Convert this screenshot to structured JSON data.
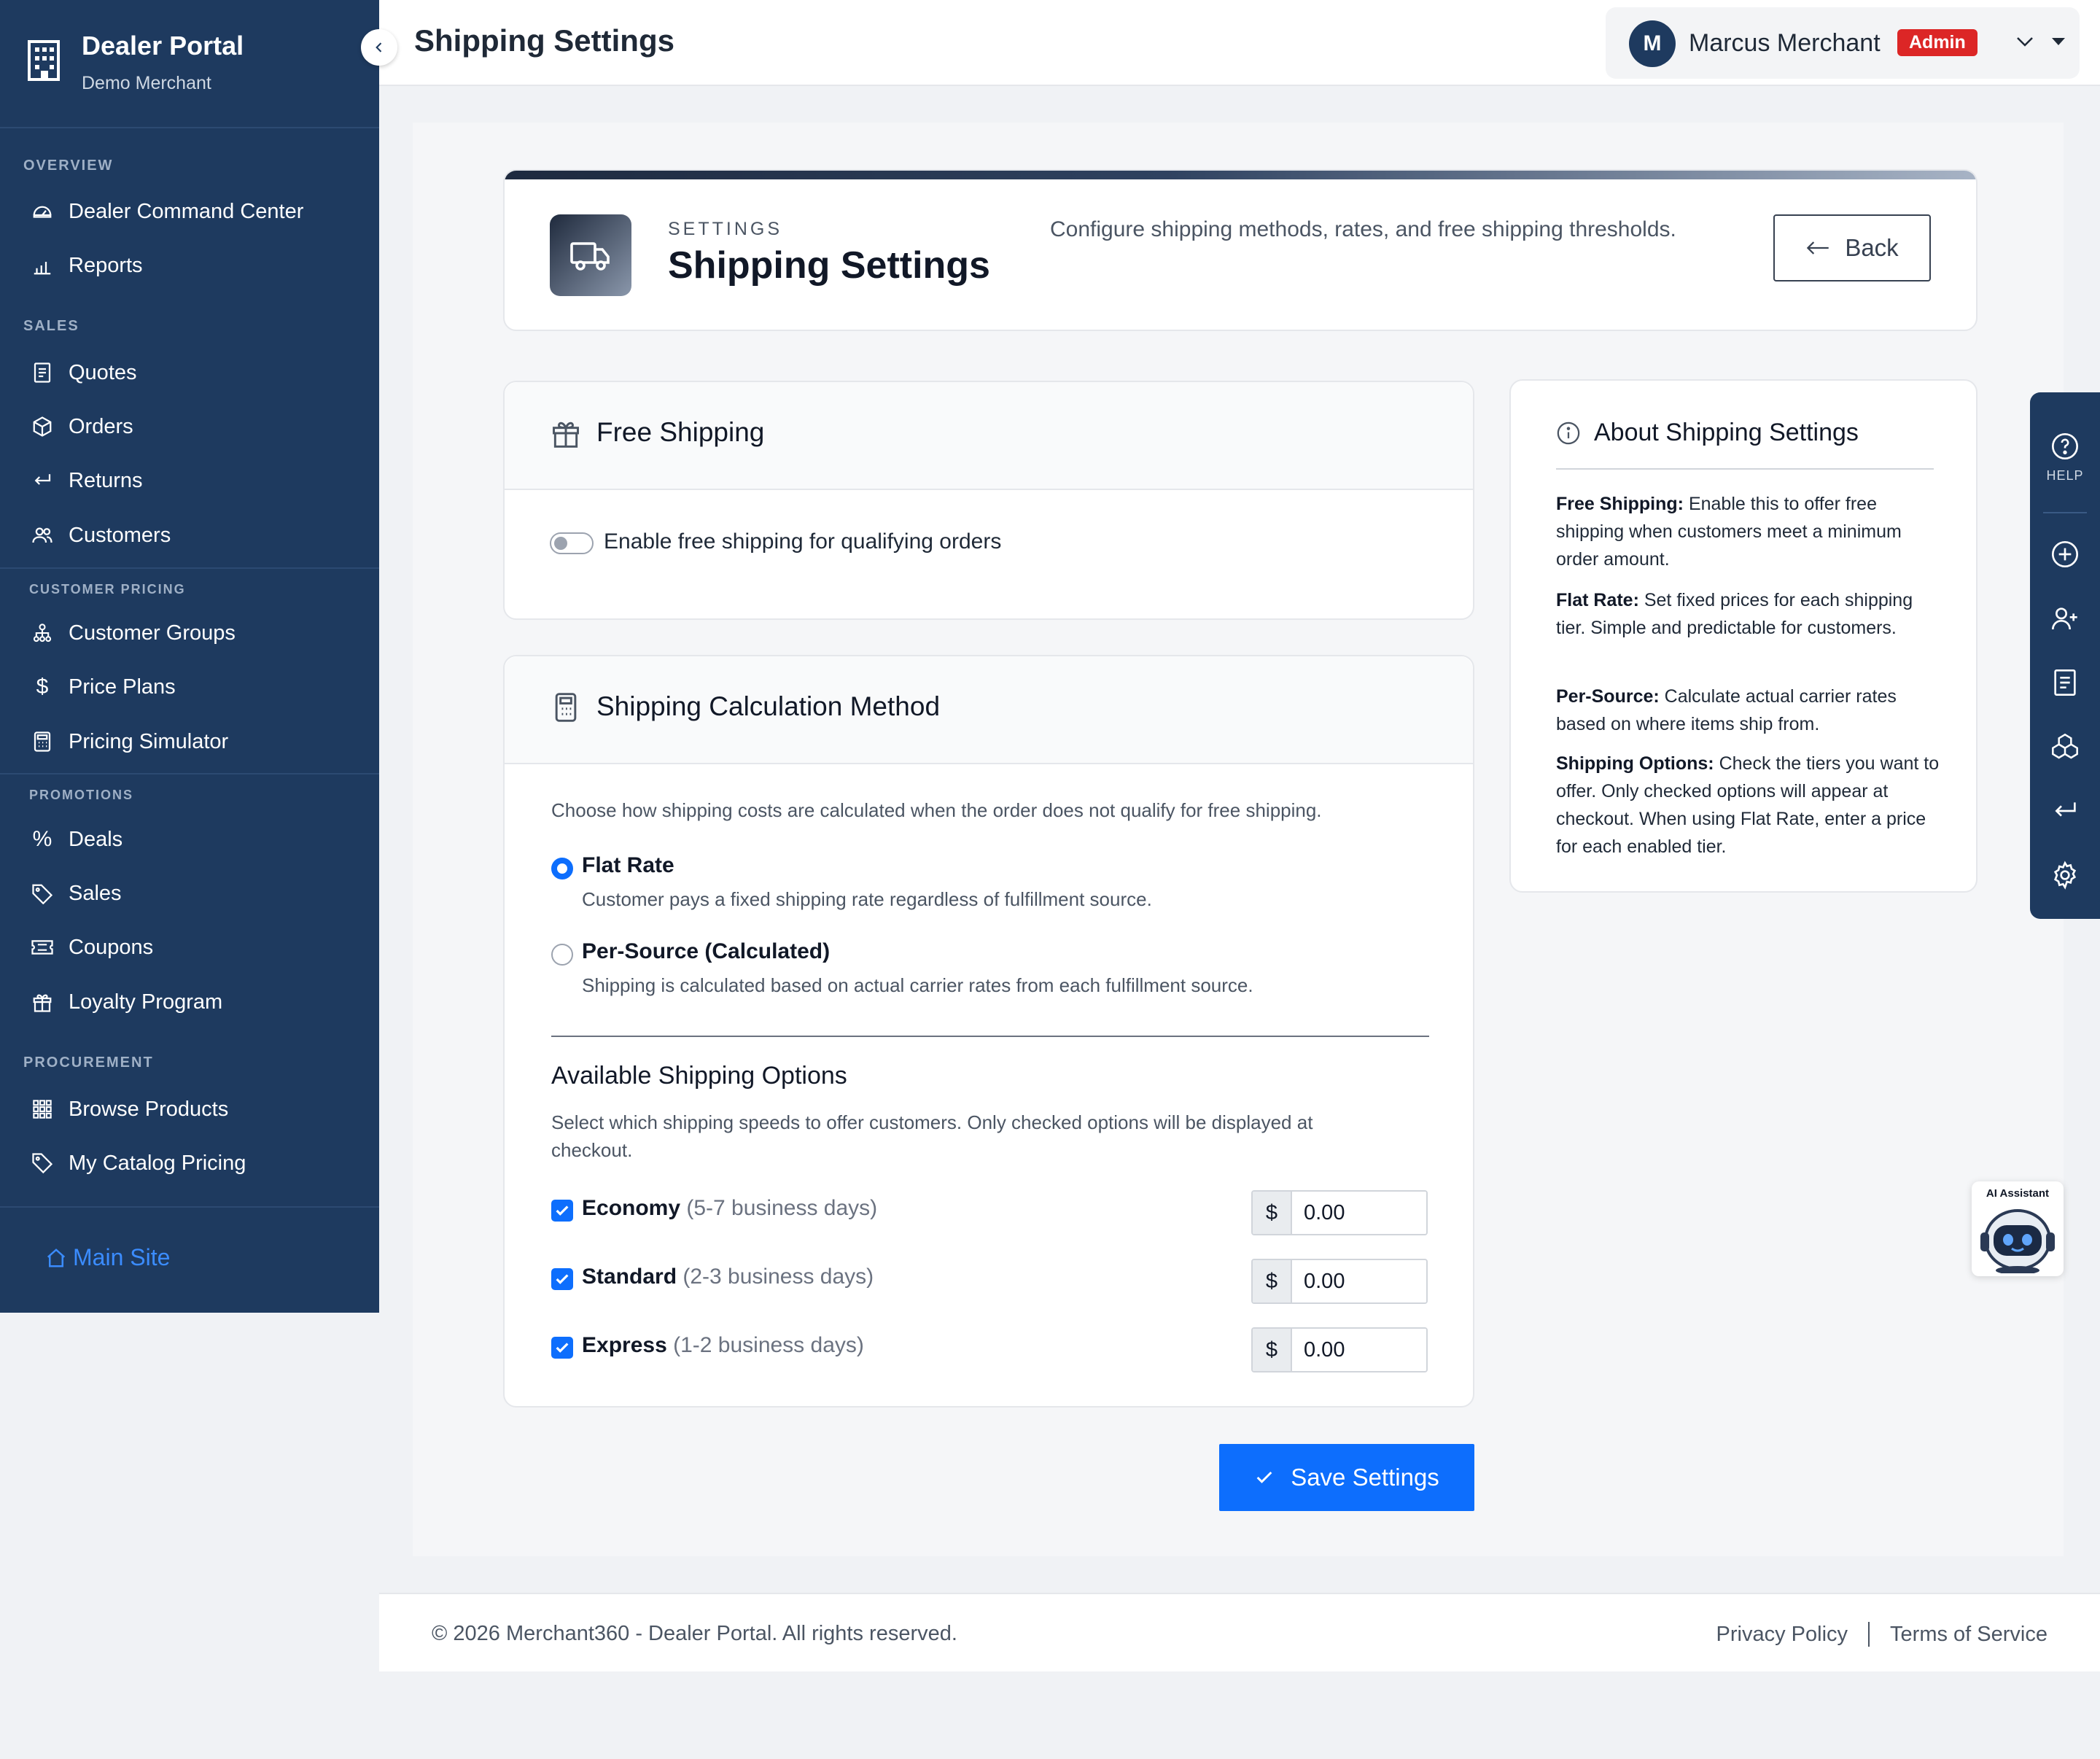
{
  "sidebar": {
    "brand_title": "Dealer Portal",
    "brand_sub": "Demo Merchant",
    "sections": [
      {
        "heading": "OVERVIEW",
        "items": [
          {
            "label": "Dealer Command Center",
            "icon": "dashboard-icon"
          },
          {
            "label": "Reports",
            "icon": "bar-chart-icon"
          }
        ]
      },
      {
        "heading": "SALES",
        "items": [
          {
            "label": "Quotes",
            "icon": "document-icon"
          },
          {
            "label": "Orders",
            "icon": "box-icon"
          },
          {
            "label": "Returns",
            "icon": "return-arrow-icon"
          },
          {
            "label": "Customers",
            "icon": "users-icon"
          }
        ]
      },
      {
        "heading": "CUSTOMER PRICING",
        "items": [
          {
            "label": "Customer Groups",
            "icon": "hierarchy-icon"
          },
          {
            "label": "Price Plans",
            "icon": "dollar-icon"
          },
          {
            "label": "Pricing Simulator",
            "icon": "calculator-icon"
          }
        ]
      },
      {
        "heading": "PROMOTIONS",
        "items": [
          {
            "label": "Deals",
            "icon": "percent-icon"
          },
          {
            "label": "Sales",
            "icon": "tag-icon"
          },
          {
            "label": "Coupons",
            "icon": "ticket-icon"
          },
          {
            "label": "Loyalty Program",
            "icon": "gift-icon"
          }
        ]
      },
      {
        "heading": "PROCUREMENT",
        "items": [
          {
            "label": "Browse Products",
            "icon": "grid-icon"
          },
          {
            "label": "My Catalog Pricing",
            "icon": "tags-icon"
          }
        ]
      }
    ],
    "main_site": "Main Site"
  },
  "topbar": {
    "title": "Shipping Settings",
    "user_initial": "M",
    "user_name": "Marcus Merchant",
    "role_badge": "Admin"
  },
  "header": {
    "eyebrow": "SETTINGS",
    "title": "Shipping Settings",
    "description": "Configure shipping methods, rates, and free shipping thresholds.",
    "back_label": "Back"
  },
  "free_shipping": {
    "title": "Free Shipping",
    "toggle_label": "Enable free shipping for qualifying orders",
    "enabled": false
  },
  "calculation": {
    "title": "Shipping Calculation Method",
    "intro": "Choose how shipping costs are calculated when the order does not qualify for free shipping.",
    "methods": [
      {
        "label": "Flat Rate",
        "desc": "Customer pays a fixed shipping rate regardless of fulfillment source.",
        "selected": true
      },
      {
        "label": "Per-Source (Calculated)",
        "desc": "Shipping is calculated based on actual carrier rates from each fulfillment source.",
        "selected": false
      }
    ],
    "options_title": "Available Shipping Options",
    "options_desc": "Select which shipping speeds to offer customers. Only checked options will be displayed at checkout.",
    "currency": "$",
    "options": [
      {
        "name": "Economy",
        "days": "(5-7 business days)",
        "price": "0.00",
        "checked": true
      },
      {
        "name": "Standard",
        "days": "(2-3 business days)",
        "price": "0.00",
        "checked": true
      },
      {
        "name": "Express",
        "days": "(1-2 business days)",
        "price": "0.00",
        "checked": true
      }
    ]
  },
  "save_label": "Save Settings",
  "about": {
    "title": "About Shipping Settings",
    "paragraphs": [
      {
        "term": "Free Shipping:",
        "text": " Enable this to offer free shipping when customers meet a minimum order amount."
      },
      {
        "term": "Flat Rate:",
        "text": " Set fixed prices for each shipping tier. Simple and predictable for customers."
      },
      {
        "term": "Per-Source:",
        "text": " Calculate actual carrier rates based on where items ship from."
      },
      {
        "term": "Shipping Options:",
        "text": " Check the tiers you want to offer. Only checked options will appear at checkout. When using Flat Rate, enter a price for each enabled tier."
      }
    ]
  },
  "help_rail": {
    "help_label": "HELP",
    "icons": [
      "question-icon",
      "plus-circle-icon",
      "add-user-icon",
      "document-icon",
      "boxes-icon",
      "return-arrow-icon",
      "gear-icon"
    ]
  },
  "ai_assistant": {
    "label": "AI Assistant"
  },
  "footer": {
    "copyright": "© 2026 Merchant360 - Dealer Portal. All rights reserved.",
    "privacy": "Privacy Policy",
    "terms": "Terms of Service"
  },
  "colors": {
    "sidebar_bg": "#1e3a5f",
    "primary": "#0d6efd",
    "badge": "#dc2626"
  }
}
